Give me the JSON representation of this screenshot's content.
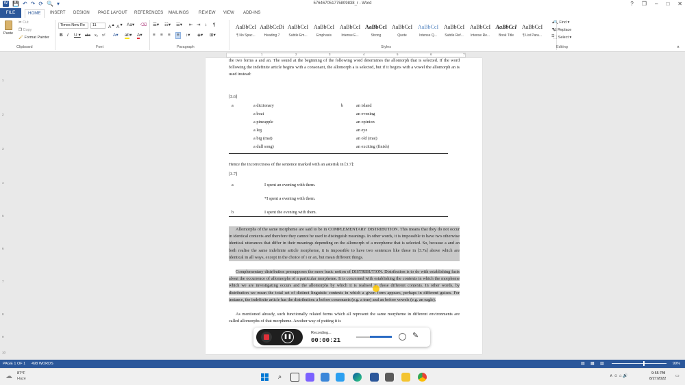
{
  "window": {
    "title": "576467051775809838_r - Word",
    "controls": [
      "?",
      "❐",
      "–",
      "□",
      "✕"
    ]
  },
  "qat": [
    "💾",
    "↶",
    "↷",
    "⟳",
    "🔍",
    "▾"
  ],
  "tabs": {
    "file": "FILE",
    "items": [
      "HOME",
      "INSERT",
      "DESIGN",
      "PAGE LAYOUT",
      "REFERENCES",
      "MAILINGS",
      "REVIEW",
      "VIEW",
      "ADD-INS"
    ],
    "active": "HOME"
  },
  "ribbon": {
    "clipboard": {
      "paste": "Paste",
      "cut": "Cut",
      "copy": "Copy",
      "format_painter": "Format Painter",
      "label": "Clipboard"
    },
    "font": {
      "name": "Times New Ro",
      "size": "11",
      "label": "Font"
    },
    "paragraph": {
      "label": "Paragraph"
    },
    "styles": {
      "label": "Styles",
      "items": [
        {
          "sample": "AaBbCcI",
          "name": "¶ No Spac..."
        },
        {
          "sample": "AaBbCcDi",
          "name": "Heading 7"
        },
        {
          "sample": "AaBbCcI",
          "name": "Subtle Em..."
        },
        {
          "sample": "AaBbCcI",
          "name": "Emphasis"
        },
        {
          "sample": "AaBbCcI",
          "name": "Intense E..."
        },
        {
          "sample": "AaBbCcI",
          "name": "Strong"
        },
        {
          "sample": "AaBbCcI",
          "name": "Quote"
        },
        {
          "sample": "AaBbCcI",
          "name": "Intense Q..."
        },
        {
          "sample": "AaBbCcI",
          "name": "Subtle Ref..."
        },
        {
          "sample": "AaBbCcI",
          "name": "Intense Re..."
        },
        {
          "sample": "AaBbCcI",
          "name": "Book Title"
        },
        {
          "sample": "AaBbCcI",
          "name": "¶ List Para..."
        }
      ]
    },
    "editing": {
      "find": "Find",
      "replace": "Replace",
      "select": "Select",
      "label": "Editing"
    }
  },
  "ruler": {
    "marks": [
      "1",
      "2",
      "3",
      "4",
      "5",
      "6",
      "7"
    ]
  },
  "vruler": {
    "marks": [
      "1",
      "2",
      "3",
      "4",
      "5",
      "6",
      "7",
      "8",
      "9",
      "10"
    ]
  },
  "document": {
    "top_para": "the two forms a and an. The sound at the beginning of the following word determines the allomorph that is selected. If the word following the indefinite article begins with a consonant, the allomorph a is selected, but if it begins with a vowel the allomorph an is used instead:",
    "ex36": {
      "label": "[3.6]",
      "a": "a",
      "b": "b",
      "col_a": [
        "a dictionary",
        "a boat",
        "a pineapple",
        "a leg",
        "a big (mat)",
        "a dull song)"
      ],
      "col_b": [
        "an island",
        "an evening",
        "an opinion",
        "an eye",
        "an old (mat)",
        "an exciting (finish)"
      ]
    },
    "hence": "Hence the incorrectness of the sentence marked with an asterisk in [3.7]:",
    "ex37": {
      "label": "[3.7]",
      "a": "a",
      "b": "b",
      "s1": "I spent an evening with them.",
      "s2": "*I spent a evening with them.",
      "s3": "I spent the evening with them."
    },
    "p1": "Allomorphs of the same morpheme are said to be in COMPLEMENTARY DISTRIBUTION. This means that they do not occur in identical contexts and therefore they cannot be used to distinguish meanings. In other words, it is impossible to have two otherwise identical utterances that differ in their meanings depending on the allomorph of a morpheme that is selected. So, because a and an both realise the same indefinite article morpheme, it is impossible to have two sentences like those in [3.7a] above which are identical in all ways, except in the choice of i or an, but mean different things.",
    "p2": "Complementary distribution presupposes the more basic notion of DISTRIBUTION. Distribution is to do with establishing facts about the occurrence of allomorphs of a particular morpheme. It is concerned with establishing the contexts in which the morpheme which we are investigating occurs and the allomorphs by which it is realised in those different contexts. In other words, by distribution we mean the total set of distinct linguistic contexts in which a given form appears, perhaps in different guises. For instance, the indefinite article has the distribution: a before consonants (e.g. a true) and an before vowels (e.g. an eagle).",
    "p3": "As mentioned already, such functionally related forms which all represent the same morpheme in different environments are called allomorphs of that morpheme. Another way of putting it is"
  },
  "recorder": {
    "status": "Recording...",
    "time": "00:00:21"
  },
  "status": {
    "page": "PAGE 1 OF 1",
    "words": "498 WORDS",
    "zoom": "99%"
  },
  "taskbar": {
    "temp": "87°F",
    "weather": "Haze",
    "time": "9:55 PM",
    "date": "8/27/2022"
  },
  "colors": {
    "accent": "#2b579a",
    "highlight": "#c9c9c9",
    "record": "#e0303a"
  }
}
